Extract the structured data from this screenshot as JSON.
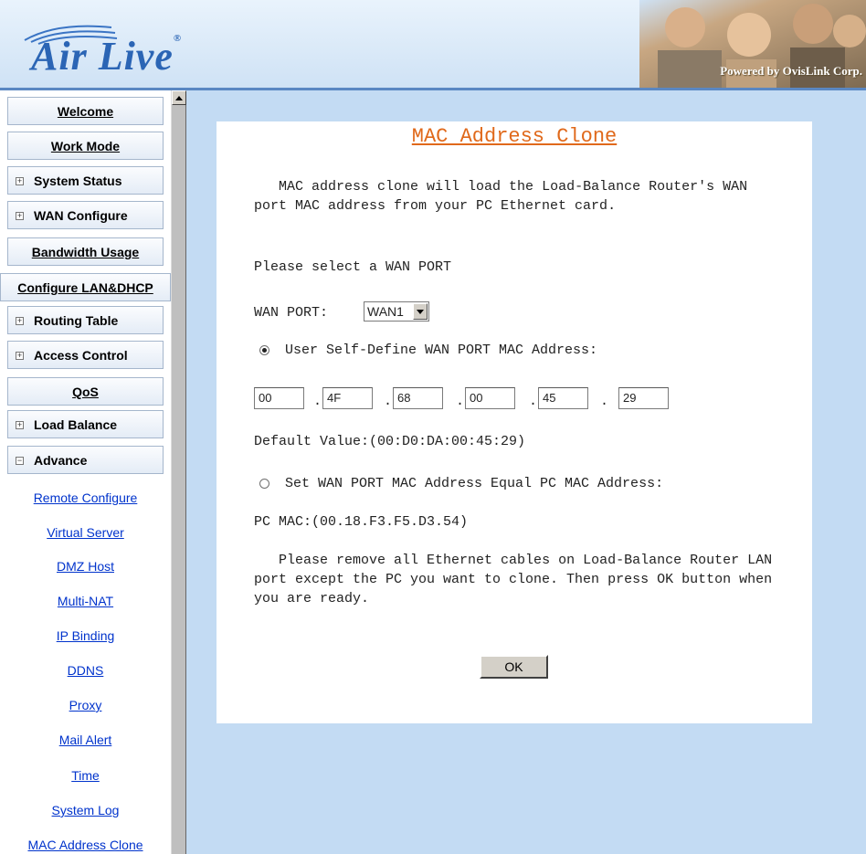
{
  "header": {
    "logo_text": "Air Live",
    "powered_by": "Powered by OvisLink Corp."
  },
  "sidebar": {
    "buttons": [
      {
        "label": "Welcome"
      },
      {
        "label": "Work Mode"
      },
      {
        "label": "System Status"
      },
      {
        "label": "WAN Configure"
      },
      {
        "label": "Bandwidth Usage"
      },
      {
        "label": "Configure LAN&DHCP"
      },
      {
        "label": "Routing Table"
      },
      {
        "label": "Access Control"
      },
      {
        "label": "QoS"
      },
      {
        "label": "Load Balance"
      },
      {
        "label": "Advance"
      }
    ],
    "expand_plus": "+",
    "expand_minus": "−",
    "sub_items": [
      {
        "label": "Remote Configure"
      },
      {
        "label": "Virtual Server"
      },
      {
        "label": "DMZ Host"
      },
      {
        "label": "Multi-NAT"
      },
      {
        "label": "IP Binding"
      },
      {
        "label": "DDNS"
      },
      {
        "label": "Proxy"
      },
      {
        "label": "Mail Alert"
      },
      {
        "label": "Time"
      },
      {
        "label": "System Log"
      },
      {
        "label": "MAC Address Clone"
      }
    ]
  },
  "main": {
    "title": "MAC Address Clone",
    "intro": "   MAC address clone will load the Load-Balance Router's WAN port MAC address from your PC Ethernet card.",
    "select_prompt": "Please select a WAN PORT",
    "wan_port_label": "WAN PORT:",
    "wan_port_value": "WAN1",
    "option1_label": "User Self-Define WAN PORT MAC Address:",
    "option1_selected": true,
    "mac_fields": [
      "00",
      "4F",
      "68",
      "00",
      "45",
      "29"
    ],
    "mac_separator": ".",
    "default_value": "Default Value:(00:D0:DA:00:45:29)",
    "option2_label": "Set WAN PORT MAC Address Equal PC MAC Address:",
    "option2_selected": false,
    "pc_mac": "PC MAC:(00.18.F3.F5.D3.54)",
    "note": "   Please remove all Ethernet cables on Load-Balance Router LAN port except the PC you want to clone. Then press OK button when you are ready.",
    "ok_label": "OK"
  },
  "colors": {
    "background": "#c3dbf3",
    "title_orange": "#e0691b",
    "link_blue": "#0033cc",
    "logo_blue": "#2b65b5"
  }
}
